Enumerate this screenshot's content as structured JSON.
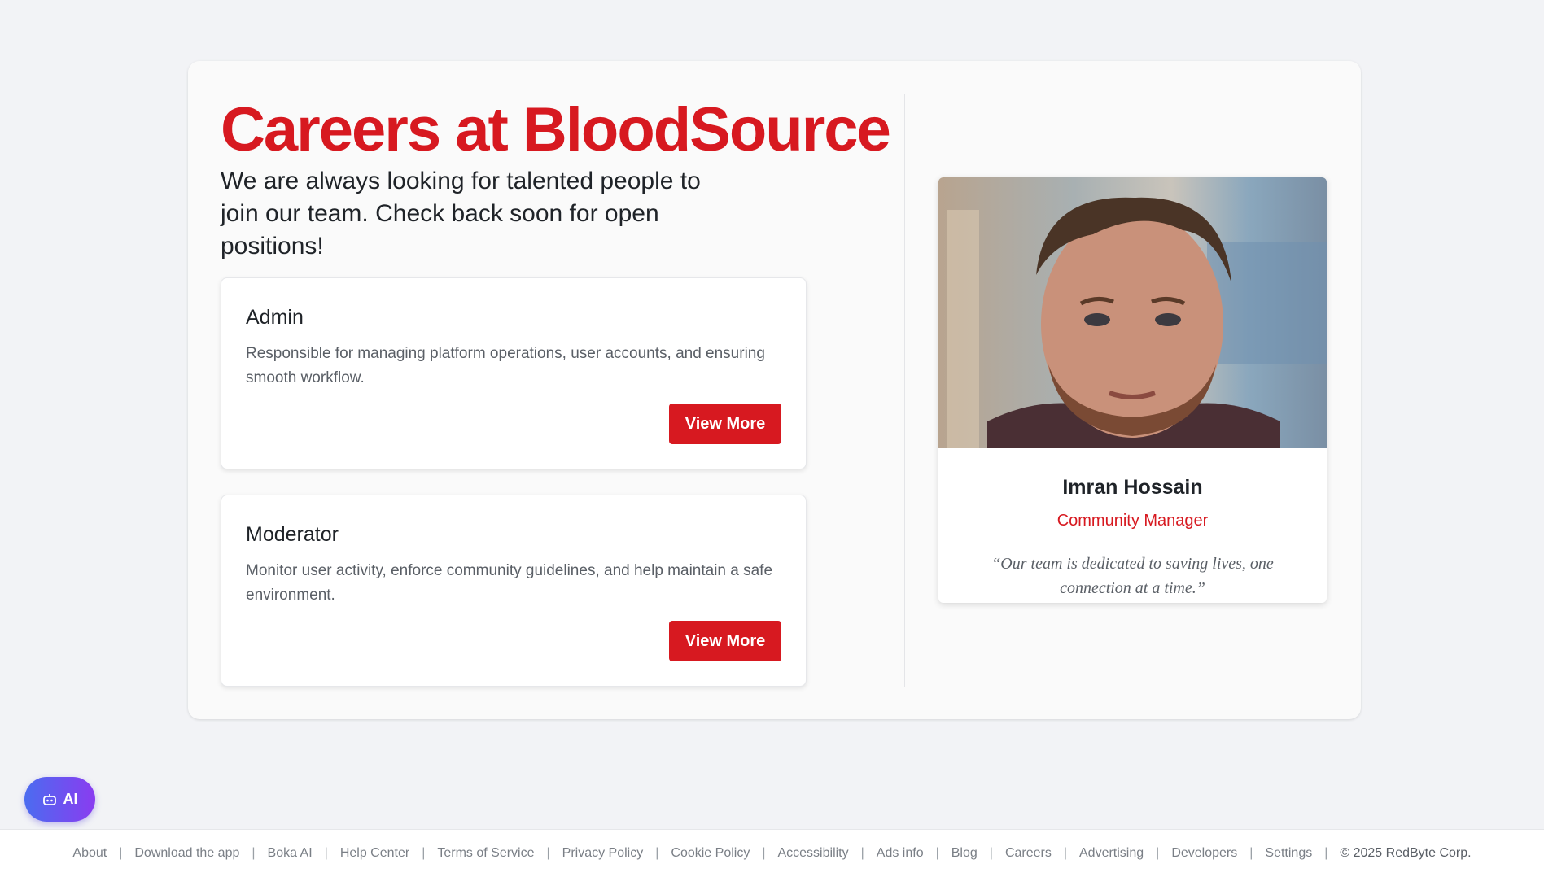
{
  "page": {
    "title": "Careers at BloodSource",
    "subtitle": "We are always looking for talented people to join our team. Check back soon for open positions!"
  },
  "jobs": [
    {
      "title": "Admin",
      "description": "Responsible for managing platform operations, user accounts, and ensuring smooth workflow.",
      "button_label": "View More"
    },
    {
      "title": "Moderator",
      "description": "Monitor user activity, enforce community guidelines, and help maintain a safe environment.",
      "button_label": "View More"
    }
  ],
  "profile": {
    "name": "Imran Hossain",
    "role": "Community Manager",
    "quote": "“Our team is dedicated to saving lives, one connection at a time.”"
  },
  "ai_button": {
    "label": "AI",
    "icon": "robot-icon"
  },
  "footer": {
    "links": [
      "About",
      "Download the app",
      "Boka AI",
      "Help Center",
      "Terms of Service",
      "Privacy Policy",
      "Cookie Policy",
      "Accessibility",
      "Ads info",
      "Blog",
      "Careers",
      "Advertising",
      "Developers",
      "Settings"
    ],
    "copyright": "© 2025 RedByte Corp."
  },
  "colors": {
    "brand_red": "#d71920",
    "background": "#f2f3f6",
    "ai_gradient_start": "#4b6cf0",
    "ai_gradient_end": "#8a3cf0"
  }
}
